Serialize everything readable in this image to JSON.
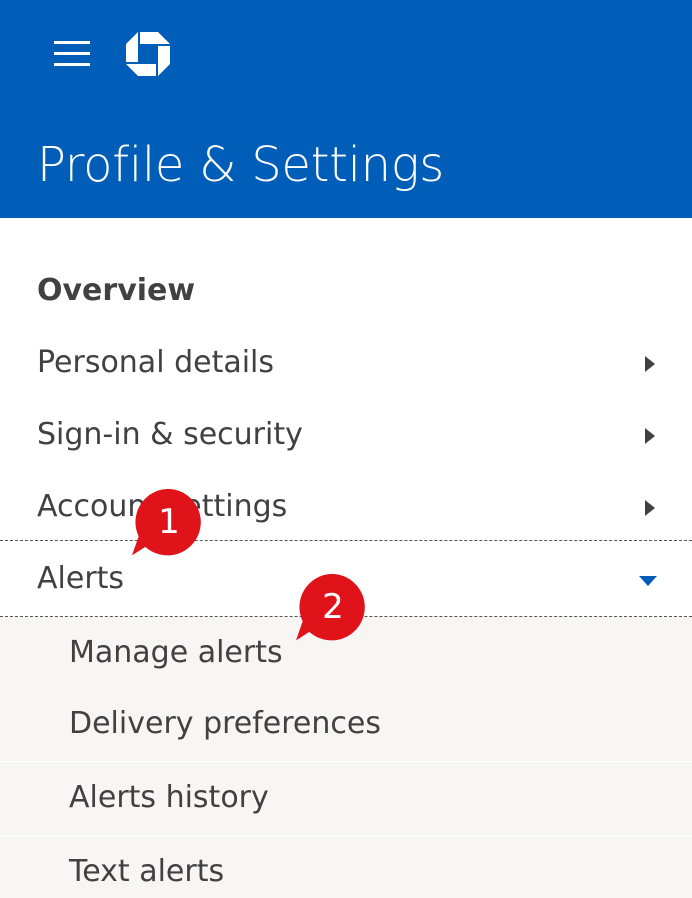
{
  "header": {
    "title": "Profile & Settings",
    "menu_icon": "hamburger-menu-icon",
    "logo_icon": "chase-octagon-logo",
    "background_color": "#005eb8"
  },
  "nav": {
    "overview": "Overview",
    "items": [
      {
        "label": "Personal details",
        "icon": "chevron-right-icon"
      },
      {
        "label": "Sign-in & security",
        "icon": "chevron-right-icon"
      },
      {
        "label": "Account settings",
        "icon": "chevron-right-icon"
      },
      {
        "label": "Alerts",
        "icon": "chevron-down-icon",
        "expanded": true
      }
    ]
  },
  "alerts_submenu": {
    "items": [
      {
        "label": "Manage alerts"
      },
      {
        "label": "Delivery preferences"
      },
      {
        "label": "Alerts history"
      },
      {
        "label": "Text alerts"
      }
    ]
  },
  "callouts": [
    {
      "number": "1"
    },
    {
      "number": "2"
    }
  ],
  "colors": {
    "brand_blue": "#005eb8",
    "callout_red": "#e0131a",
    "submenu_bg": "#f7f6f4",
    "text": "#414042"
  }
}
